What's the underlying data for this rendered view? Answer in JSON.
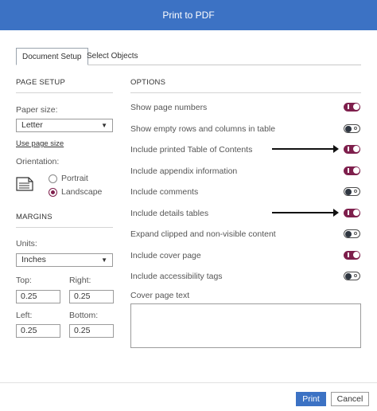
{
  "dialog": {
    "title": "Print to PDF"
  },
  "tabs": [
    {
      "label": "Document Setup",
      "active": true
    },
    {
      "label": "Select Objects",
      "active": false
    }
  ],
  "page_setup": {
    "title": "PAGE SETUP",
    "paper_size_label": "Paper size:",
    "paper_size_value": "Letter",
    "use_page_size_link": "Use page size",
    "orientation_label": "Orientation:",
    "orientation_options": [
      {
        "label": "Portrait",
        "selected": false
      },
      {
        "label": "Landscape",
        "selected": true
      }
    ]
  },
  "margins": {
    "title": "MARGINS",
    "units_label": "Units:",
    "units_value": "Inches",
    "top_label": "Top:",
    "top_value": "0.25",
    "right_label": "Right:",
    "right_value": "0.25",
    "left_label": "Left:",
    "left_value": "0.25",
    "bottom_label": "Bottom:",
    "bottom_value": "0.25"
  },
  "options": {
    "title": "OPTIONS",
    "items": [
      {
        "label": "Show page numbers",
        "on": true
      },
      {
        "label": "Show empty rows and columns in table",
        "on": false
      },
      {
        "label": "Include printed Table of Contents",
        "on": true
      },
      {
        "label": "Include appendix information",
        "on": true
      },
      {
        "label": "Include comments",
        "on": false
      },
      {
        "label": "Include details tables",
        "on": true
      },
      {
        "label": "Expand clipped and non-visible content",
        "on": false
      },
      {
        "label": "Include cover page",
        "on": true
      },
      {
        "label": "Include accessibility tags",
        "on": false
      }
    ],
    "cover_page_text_label": "Cover page text",
    "cover_page_text_value": ""
  },
  "buttons": {
    "print": "Print",
    "cancel": "Cancel"
  },
  "colors": {
    "header": "#3c72c4",
    "accent": "#7e1f4c"
  }
}
